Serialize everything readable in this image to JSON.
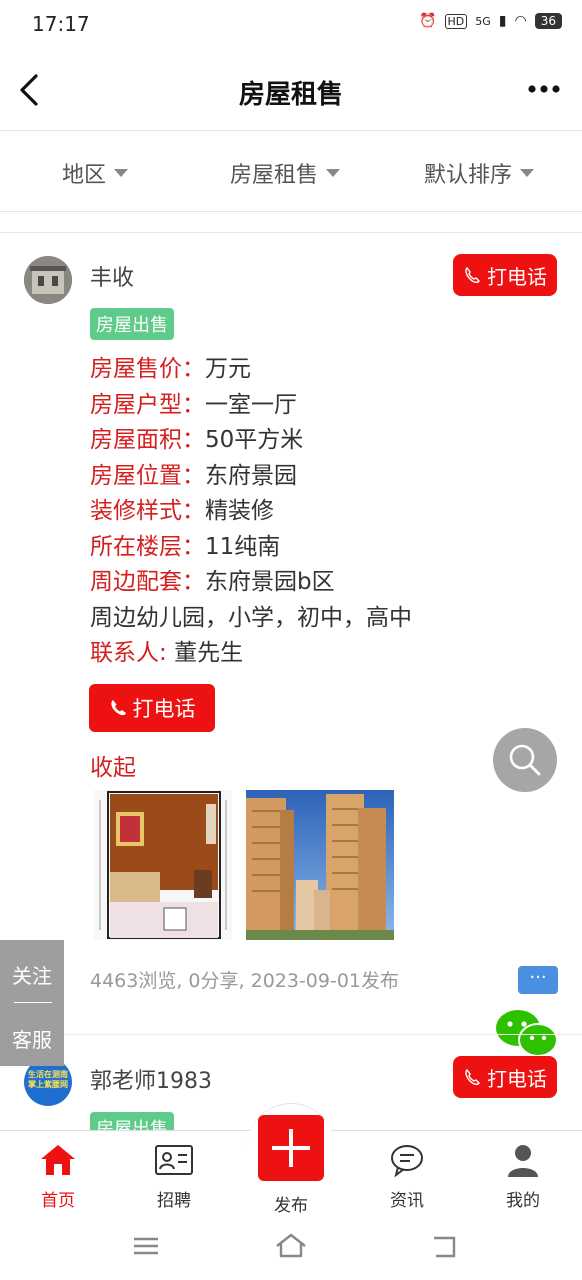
{
  "status_bar": {
    "time": "17:17",
    "network": "5G",
    "hd": "HD",
    "battery": "36"
  },
  "header": {
    "title": "房屋租售"
  },
  "filters": [
    {
      "label": "地区"
    },
    {
      "label": "房屋租售"
    },
    {
      "label": "默认排序"
    }
  ],
  "posts": [
    {
      "username": "丰收",
      "call_label": "打电话",
      "tag": "房屋出售",
      "fields": [
        {
          "key": "房屋售价：",
          "value": "万元"
        },
        {
          "key": "房屋户型：",
          "value": "一室一厅"
        },
        {
          "key": "房屋面积：",
          "value": "50平方米"
        },
        {
          "key": "房屋位置：",
          "value": "东府景园"
        },
        {
          "key": "装修样式：",
          "value": "精装修"
        },
        {
          "key": "所在楼层：",
          "value": "11纯南"
        },
        {
          "key": "周边配套：",
          "value": "东府景园b区"
        }
      ],
      "extra_line": "周边幼儿园，小学，初中，高中",
      "contact_key": "联系人: ",
      "contact_value": "董先生",
      "big_call_label": "打电话",
      "collapse_label": "收起",
      "meta": "4463浏览, 0分享, 2023-09-01发布",
      "comment_icon": "···"
    },
    {
      "username": "郭老师1983",
      "call_label": "打电话",
      "tag": "房屋出售",
      "avatar_text": [
        "生活在测南",
        "掌上紫腰网"
      ]
    }
  ],
  "side_panel": {
    "follow": "关注",
    "service": "客服"
  },
  "bottom_nav": [
    {
      "label": "首页",
      "icon": "home-icon",
      "active": true
    },
    {
      "label": "招聘",
      "icon": "id-card-icon"
    },
    {
      "label": "发布",
      "icon": "plus-icon"
    },
    {
      "label": "资讯",
      "icon": "chat-bubble-icon"
    },
    {
      "label": "我的",
      "icon": "person-icon"
    }
  ],
  "colors": {
    "accent": "#ee1111",
    "label_red": "#d61f1f",
    "tag_green": "#5fcb8a"
  }
}
